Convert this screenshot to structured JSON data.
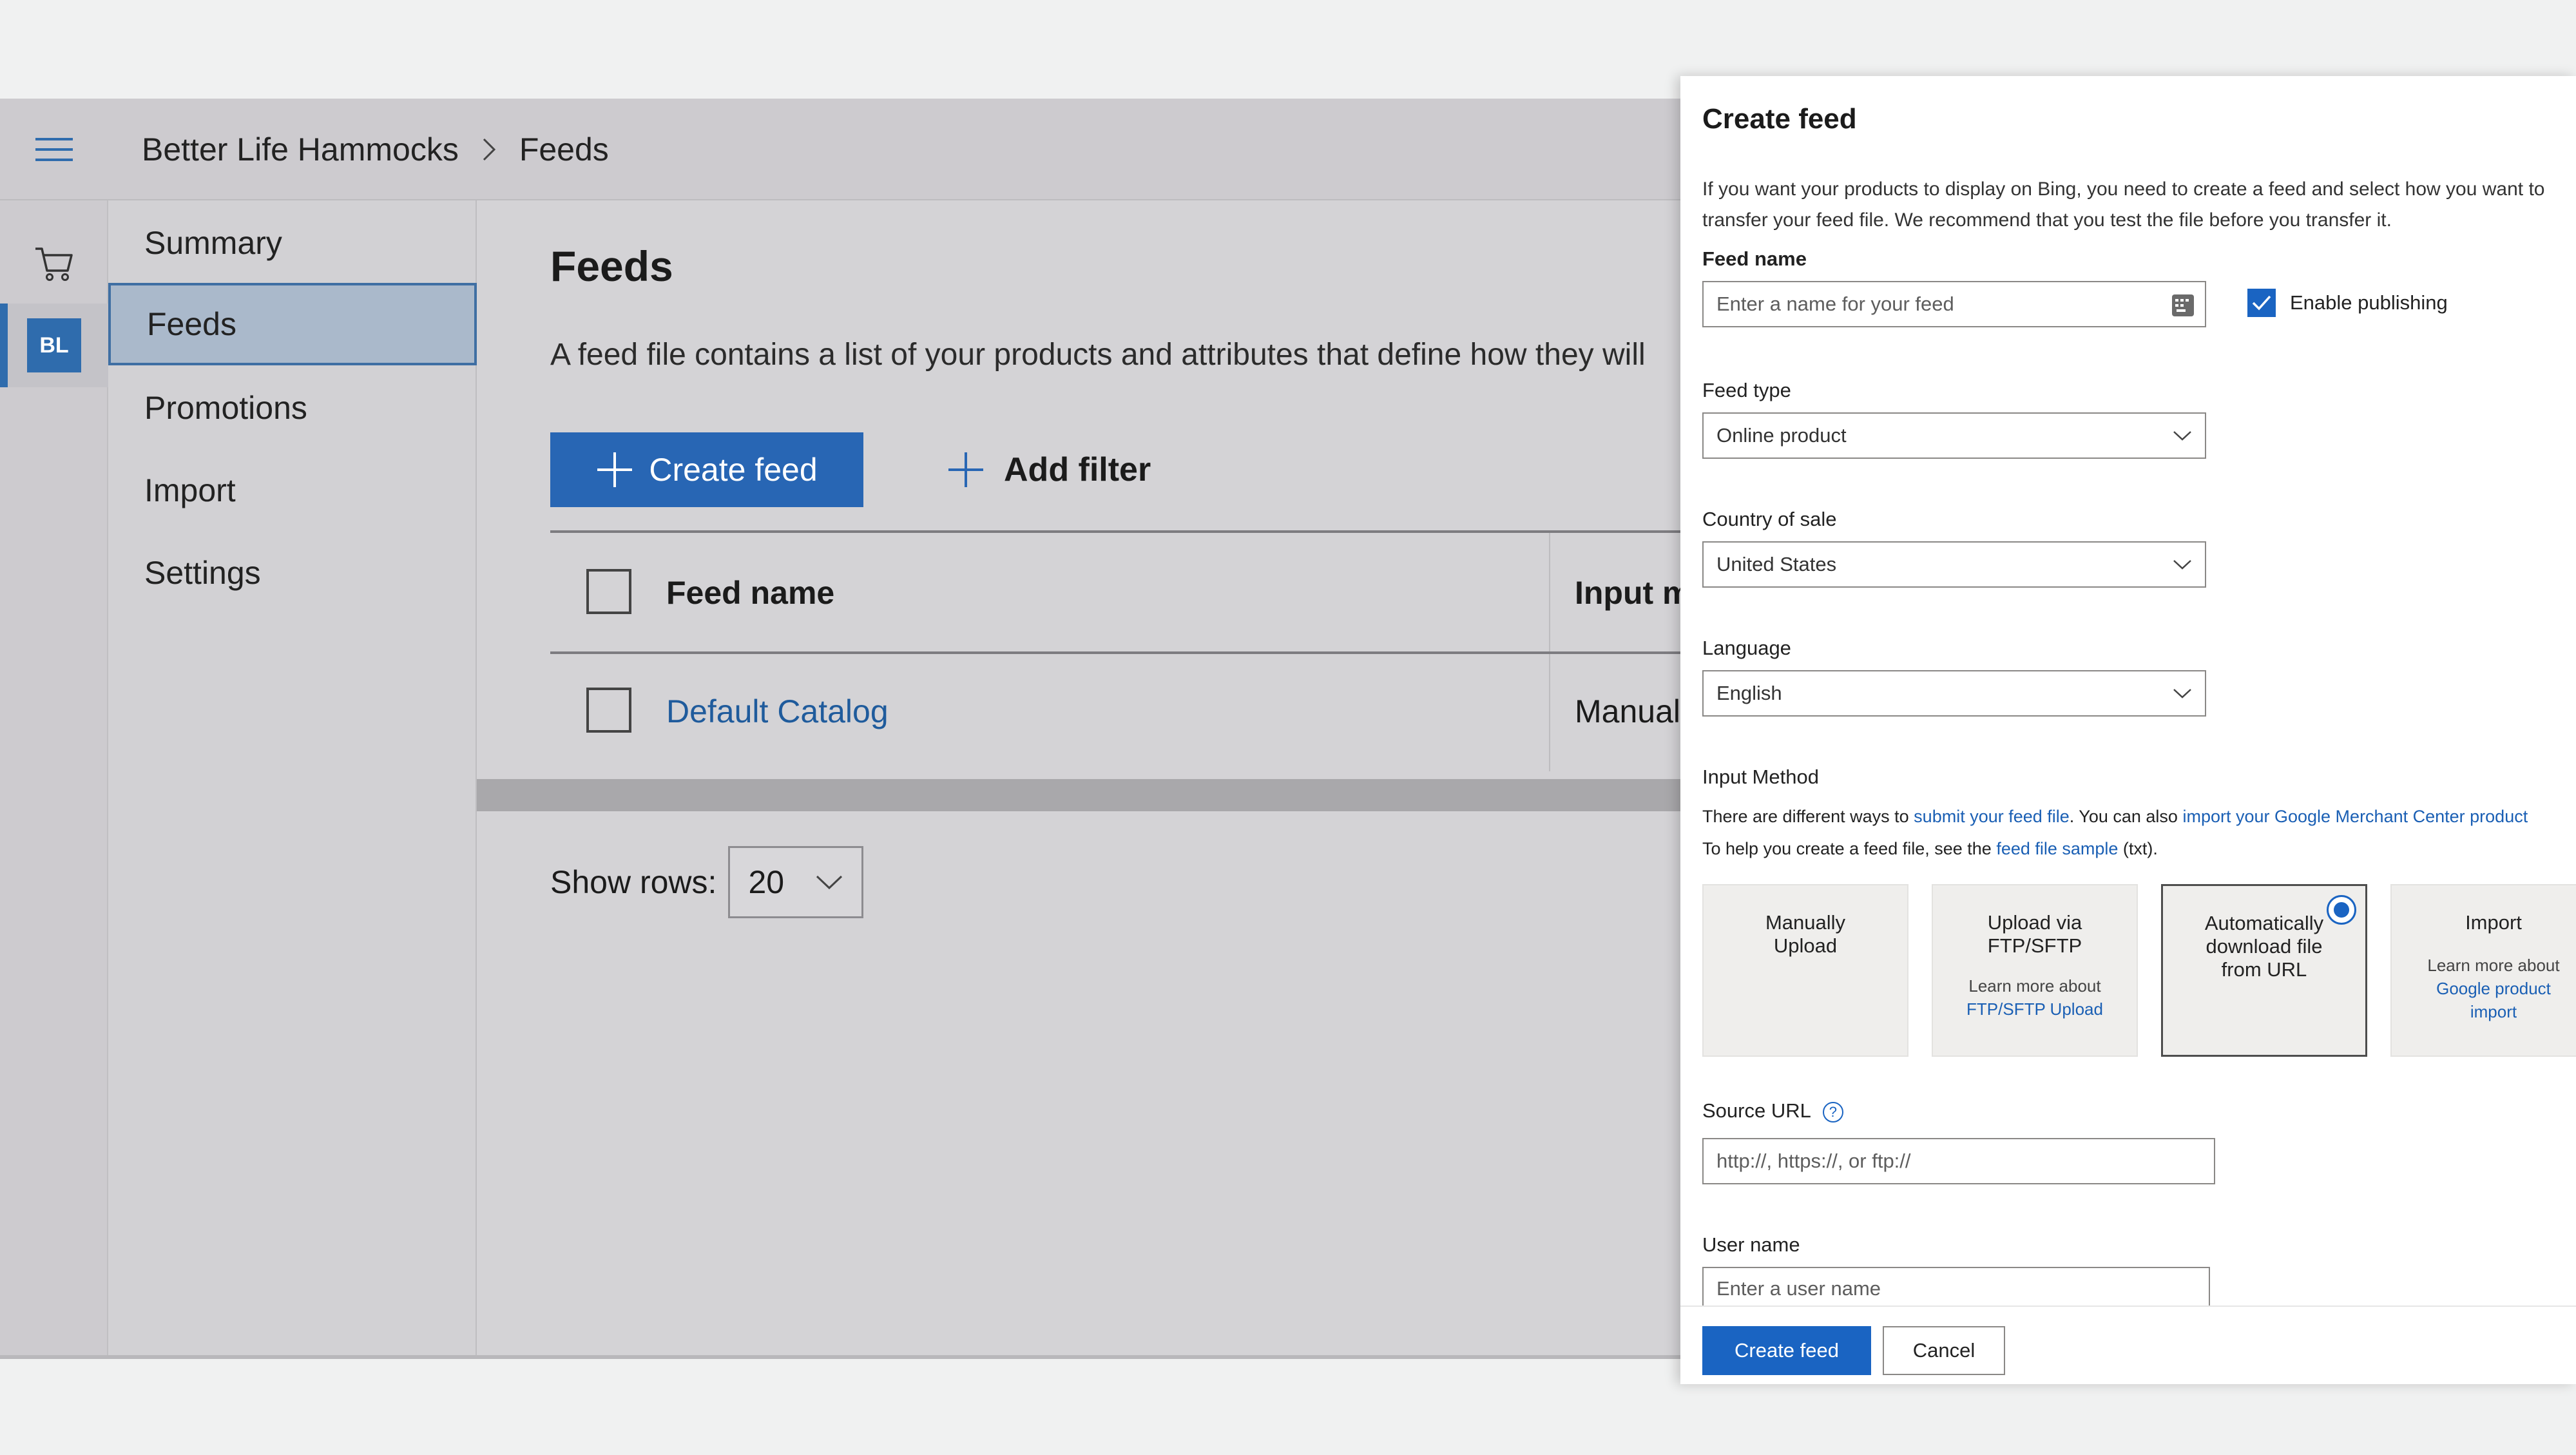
{
  "app": {
    "breadcrumb": {
      "account": "Better Life Hammocks",
      "page": "Feeds"
    },
    "rail": {
      "badge": "BL",
      "cart_icon": "shopping-cart-icon",
      "menu_icon": "hamburger-icon"
    },
    "nav": {
      "items": [
        "Summary",
        "Feeds",
        "Promotions",
        "Import",
        "Settings"
      ],
      "active": "Feeds"
    },
    "main": {
      "title": "Feeds",
      "description": "A feed file contains a list of your products and attributes that define how they will",
      "create_button": "Create feed",
      "filter_button": "Add filter",
      "table": {
        "columns": [
          "Feed name",
          "Input m"
        ],
        "rows": [
          {
            "name": "Default Catalog",
            "input_method": "Manual U"
          }
        ]
      },
      "show_rows_label": "Show rows:",
      "show_rows_value": "20"
    }
  },
  "panel": {
    "title": "Create feed",
    "description": "If you want your products to display on Bing, you need to create a feed and select how you want to transfer your feed file. We recommend that you test the file before you transfer it.",
    "feed_name": {
      "label": "Feed name",
      "placeholder": "Enter a name for your feed",
      "value": ""
    },
    "enable_publishing": {
      "label": "Enable publishing",
      "checked": true
    },
    "feed_type": {
      "label": "Feed type",
      "value": "Online product"
    },
    "country": {
      "label": "Country of sale",
      "value": "United States"
    },
    "language": {
      "label": "Language",
      "value": "English"
    },
    "input_method": {
      "label": "Input Method",
      "line1_prefix": "There are different ways to ",
      "line1_link1": "submit your feed file",
      "line1_middle": ". You can also ",
      "line1_link2": "import your Google Merchant Center product",
      "line2_prefix": "To help you create a feed file, see the ",
      "line2_link": "feed file sample",
      "line2_suffix": " (txt).",
      "options": [
        {
          "title_l1": "Manually",
          "title_l2": "Upload",
          "title_l3": ""
        },
        {
          "title_l1": "Upload via",
          "title_l2": "FTP/SFTP",
          "title_l3": "",
          "note": "Learn more about",
          "note_link": "FTP/SFTP Upload"
        },
        {
          "title_l1": "Automatically",
          "title_l2": "download file",
          "title_l3": "from URL",
          "selected": true
        },
        {
          "title_l1": "Import",
          "title_l2": "",
          "title_l3": "",
          "note": "Learn more about",
          "note_link_l1": "Google product",
          "note_link_l2": "import"
        }
      ]
    },
    "source_url": {
      "label": "Source URL",
      "placeholder": "http://, https://, or ftp://"
    },
    "user_name": {
      "label": "User name",
      "placeholder": "Enter a user name"
    },
    "buttons": {
      "primary": "Create feed",
      "secondary": "Cancel"
    },
    "colors": {
      "accent": "#1a64c2",
      "link": "#1a5fb4"
    }
  }
}
